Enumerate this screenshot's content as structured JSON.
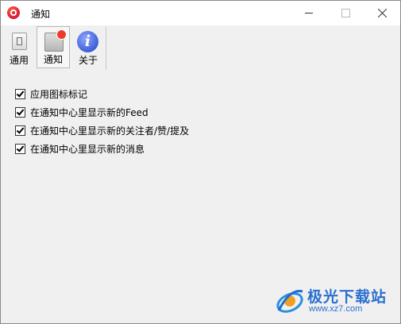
{
  "window": {
    "title": "通知",
    "icon": "app-logo-icon",
    "controls": [
      "minimize-icon",
      "maximize-icon",
      "close-icon"
    ]
  },
  "toolbar": {
    "items": [
      {
        "label": "通用",
        "icon": "general-switch-icon",
        "selected": false
      },
      {
        "label": "通知",
        "icon": "notification-badge-icon",
        "selected": true
      },
      {
        "label": "关于",
        "icon": "info-icon",
        "selected": false
      }
    ]
  },
  "options": [
    {
      "label": "应用图标标记",
      "checked": true
    },
    {
      "label": "在通知中心里显示新的Feed",
      "checked": true
    },
    {
      "label": "在通知中心里显示新的关注者/赞/提及",
      "checked": true
    },
    {
      "label": "在通知中心里显示新的消息",
      "checked": true
    }
  ],
  "watermark": {
    "title": "极光下载站",
    "url": "www.xz7.com"
  },
  "colors": {
    "notify_dot": "#ef3b2c",
    "about_icon": "#3f5fd6",
    "watermark": "#2a6fcf"
  }
}
